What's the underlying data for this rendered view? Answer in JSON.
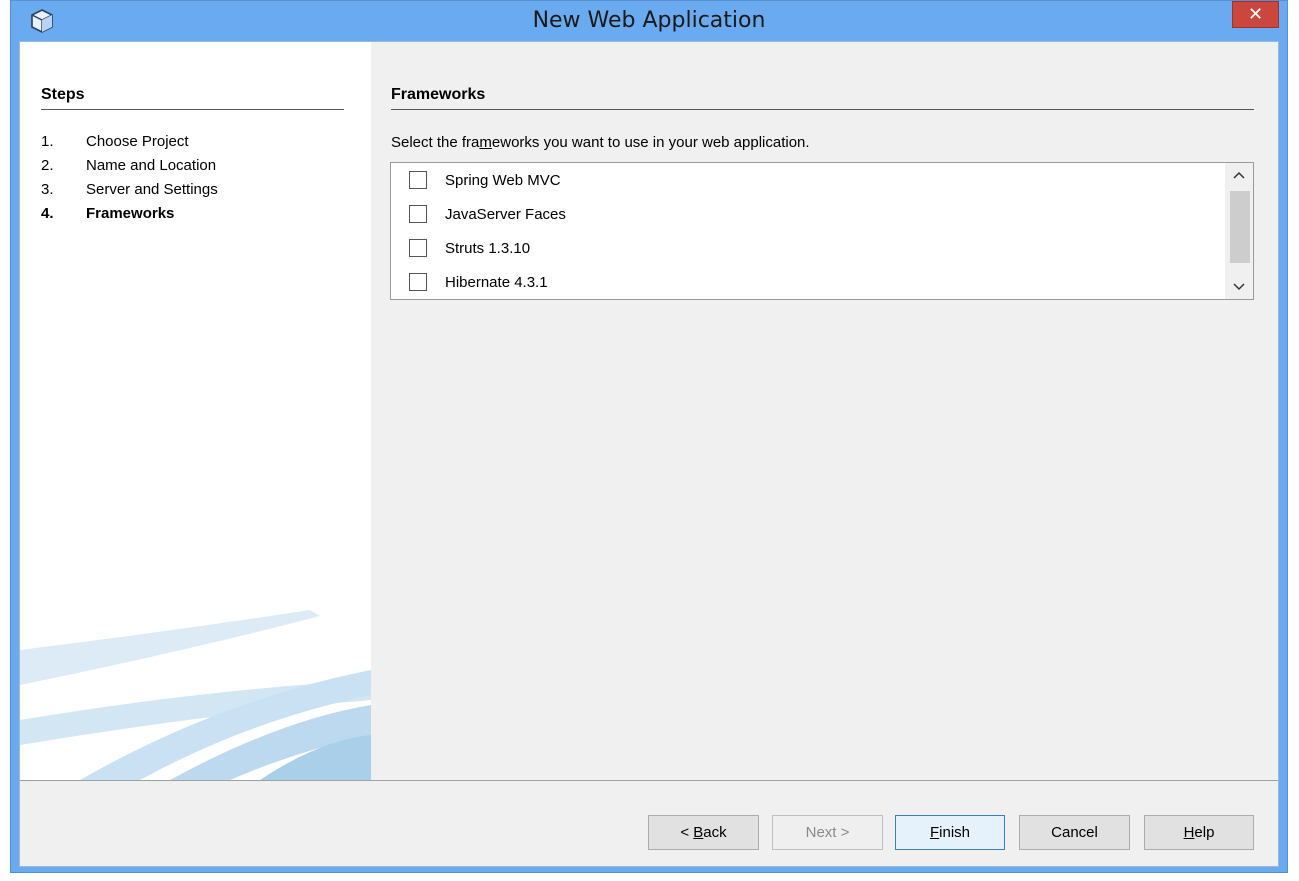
{
  "window": {
    "title": "New Web Application",
    "close_label": "✕"
  },
  "steps": {
    "header": "Steps",
    "items": [
      {
        "num": "1.",
        "label": "Choose Project"
      },
      {
        "num": "2.",
        "label": "Name and Location"
      },
      {
        "num": "3.",
        "label": "Server and Settings"
      },
      {
        "num": "4.",
        "label": "Frameworks"
      }
    ],
    "current_index": 3
  },
  "frameworks": {
    "header": "Frameworks",
    "description_pre": "Select the fra",
    "description_mnemonic": "m",
    "description_post": "eworks you want to use in your web application.",
    "items": [
      {
        "label": "Spring Web MVC",
        "checked": false
      },
      {
        "label": "JavaServer Faces",
        "checked": false
      },
      {
        "label": "Struts 1.3.10",
        "checked": false
      },
      {
        "label": "Hibernate 4.3.1",
        "checked": false
      }
    ],
    "scroll_up_icon": "chevron-up-icon",
    "scroll_down_icon": "chevron-down-icon"
  },
  "buttons": {
    "back_pre": "< ",
    "back_mnemonic": "B",
    "back_post": "ack",
    "next": "Next >",
    "finish_mnemonic": "F",
    "finish_post": "inish",
    "cancel": "Cancel",
    "help_mnemonic": "H",
    "help_post": "elp"
  },
  "colors": {
    "titlebar": "#6aaaf0",
    "close": "#c9473d",
    "panel": "#f0f0f0"
  }
}
